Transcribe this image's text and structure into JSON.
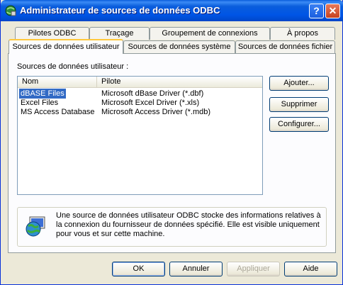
{
  "window": {
    "title": "Administrateur de sources de données ODBC"
  },
  "titlebar": {
    "help_label": "?",
    "close_label": "✕"
  },
  "tabs": {
    "row1": [
      {
        "label": "Pilotes ODBC"
      },
      {
        "label": "Traçage"
      },
      {
        "label": "Groupement de connexions"
      },
      {
        "label": "À propos"
      }
    ],
    "row2": [
      {
        "label": "Sources de données utilisateur",
        "active": true
      },
      {
        "label": "Sources de données système"
      },
      {
        "label": "Sources de données fichier"
      }
    ]
  },
  "panel": {
    "label": "Sources de données utilisateur :",
    "columns": [
      "Nom",
      "Pilote"
    ],
    "rows": [
      {
        "name": "dBASE Files",
        "driver": "Microsoft dBase Driver (*.dbf)",
        "selected": true
      },
      {
        "name": "Excel Files",
        "driver": "Microsoft Excel Driver (*.xls)"
      },
      {
        "name": "MS Access Database",
        "driver": "Microsoft Access Driver (*.mdb)"
      }
    ],
    "buttons": {
      "add": "Ajouter...",
      "remove": "Supprimer",
      "configure": "Configurer..."
    },
    "info_text": "Une source de données utilisateur ODBC stocke des informations relatives à la connexion du fournisseur de données spécifié. Elle est visible uniquement pour vous et sur cette machine."
  },
  "footer": {
    "ok": "OK",
    "cancel": "Annuler",
    "apply": "Appliquer",
    "help": "Aide"
  },
  "colors": {
    "title_bar": "#0055e5",
    "selection": "#316ac5",
    "active_tab_accent": "#ffc83c"
  }
}
